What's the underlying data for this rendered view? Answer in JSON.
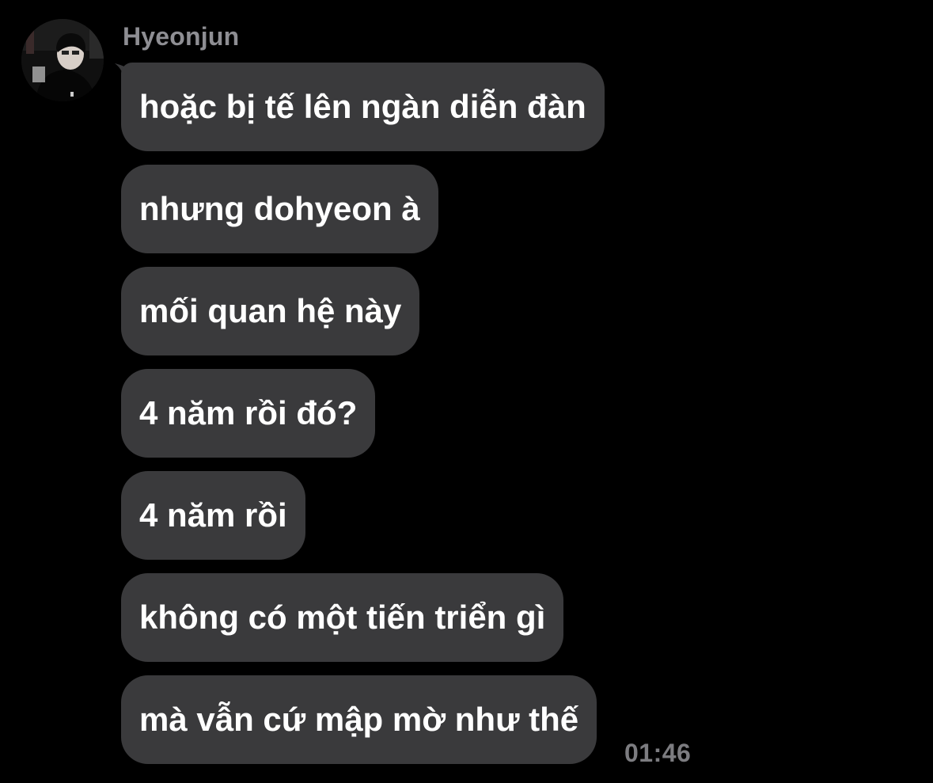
{
  "chat": {
    "sender_name": "Hyeonjun",
    "messages": [
      {
        "text": "hoặc bị tế lên ngàn diễn đàn"
      },
      {
        "text": "nhưng dohyeon à"
      },
      {
        "text": "mối quan hệ này"
      },
      {
        "text": "4 năm rồi đó?"
      },
      {
        "text": "4 năm rồi"
      },
      {
        "text": "không có một tiến triển gì"
      },
      {
        "text": "mà vẫn cứ mập mờ như thế"
      }
    ],
    "timestamp": "01:46"
  },
  "colors": {
    "background": "#000000",
    "bubble": "#3a3a3c",
    "message_text": "#ffffff",
    "sender_name": "#8e8e93",
    "timestamp": "#7c7c80"
  }
}
